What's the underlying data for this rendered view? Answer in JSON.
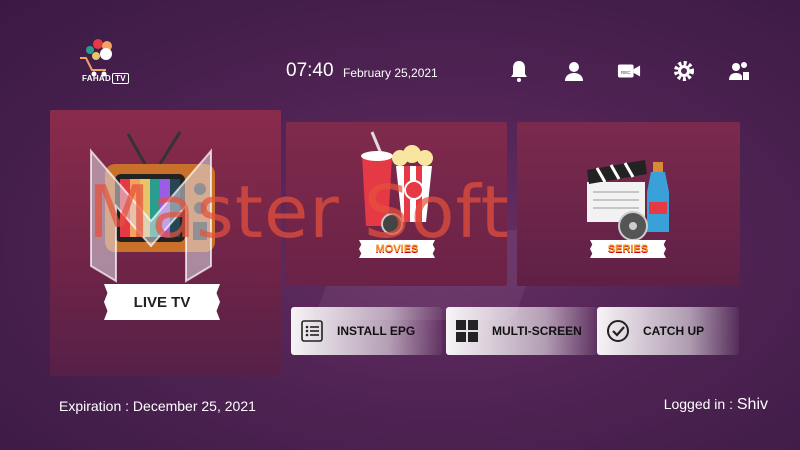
{
  "header": {
    "logo_text": "FAHAD",
    "logo_tv": "TV",
    "time": "07:40",
    "date": "February 25,2021",
    "icons": [
      "bell-icon",
      "user-icon",
      "record-icon",
      "settings-icon",
      "switch-user-icon"
    ],
    "record_label": "REC"
  },
  "tiles": {
    "live": {
      "label": "LIVE TV"
    },
    "movies": {
      "label": "MOVIES"
    },
    "series": {
      "label": "SERIES"
    }
  },
  "actions": {
    "epg": {
      "label": "INSTALL EPG",
      "icon": "list-icon"
    },
    "multi": {
      "label": "MULTI-SCREEN",
      "icon": "grid-icon"
    },
    "catch": {
      "label": "CATCH UP",
      "icon": "check-circle-icon"
    }
  },
  "footer": {
    "expiration": "Expiration : December 25, 2021",
    "logged_prefix": "Logged in : ",
    "user": "Shiv"
  },
  "watermark": "Master Soft",
  "colors": {
    "background": "#4f2353",
    "tile": "#7a2a4c",
    "accent": "#f0a02a",
    "watermark": "#e6503c"
  }
}
